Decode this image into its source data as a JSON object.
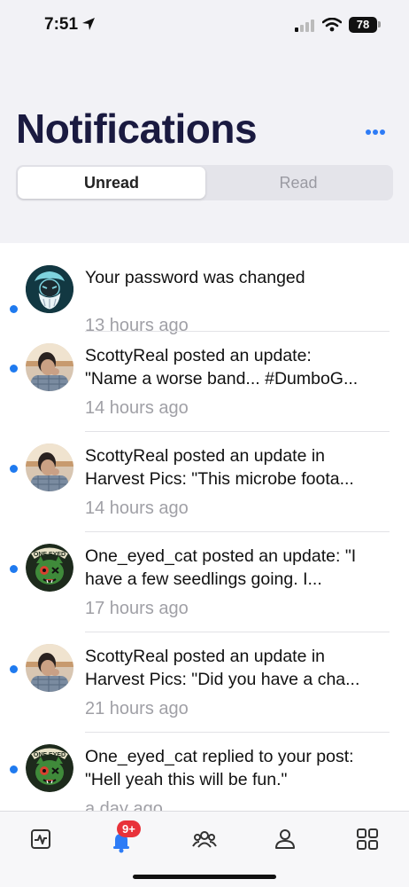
{
  "status_bar": {
    "time": "7:51",
    "battery": "78"
  },
  "header": {
    "title": "Notifications",
    "more_icon": "ellipsis-icon"
  },
  "tabs": {
    "unread": "Unread",
    "read": "Read"
  },
  "notifications": [
    {
      "text_line1": "Your password was changed",
      "text_line2": "",
      "time": "13 hours ago",
      "avatar": "zeus-logo",
      "unread": true
    },
    {
      "text_line1": "ScottyReal posted an update:",
      "text_line2": "\"Name a worse band... #DumboG...",
      "time": "14 hours ago",
      "avatar": "scottyreal-photo",
      "unread": true
    },
    {
      "text_line1": "ScottyReal posted an update in",
      "text_line2": "Harvest Pics: \"This microbe foota...",
      "time": "14 hours ago",
      "avatar": "scottyreal-photo",
      "unread": true
    },
    {
      "text_line1": "One_eyed_cat posted an update: \"I",
      "text_line2": "have a few seedlings going. I...",
      "time": "17 hours ago",
      "avatar": "one-eyed-cat-logo",
      "unread": true
    },
    {
      "text_line1": "ScottyReal posted an update in",
      "text_line2": "Harvest Pics: \"Did you have a cha...",
      "time": "21 hours ago",
      "avatar": "scottyreal-photo",
      "unread": true
    },
    {
      "text_line1": "One_eyed_cat replied to your post:",
      "text_line2": "\"Hell yeah this will be fun.\"",
      "time": "a day ago",
      "avatar": "one-eyed-cat-logo",
      "unread": true
    }
  ],
  "avatar_labels": {
    "one_eyed_cat": "ONE EYED"
  },
  "tab_bar": {
    "items": [
      "activity-icon",
      "notifications-bell-icon",
      "groups-icon",
      "profile-icon",
      "apps-grid-icon"
    ],
    "badge": "9+"
  },
  "colors": {
    "accent": "#1f7aef",
    "badge": "#e8323a",
    "title": "#1a1a40"
  }
}
